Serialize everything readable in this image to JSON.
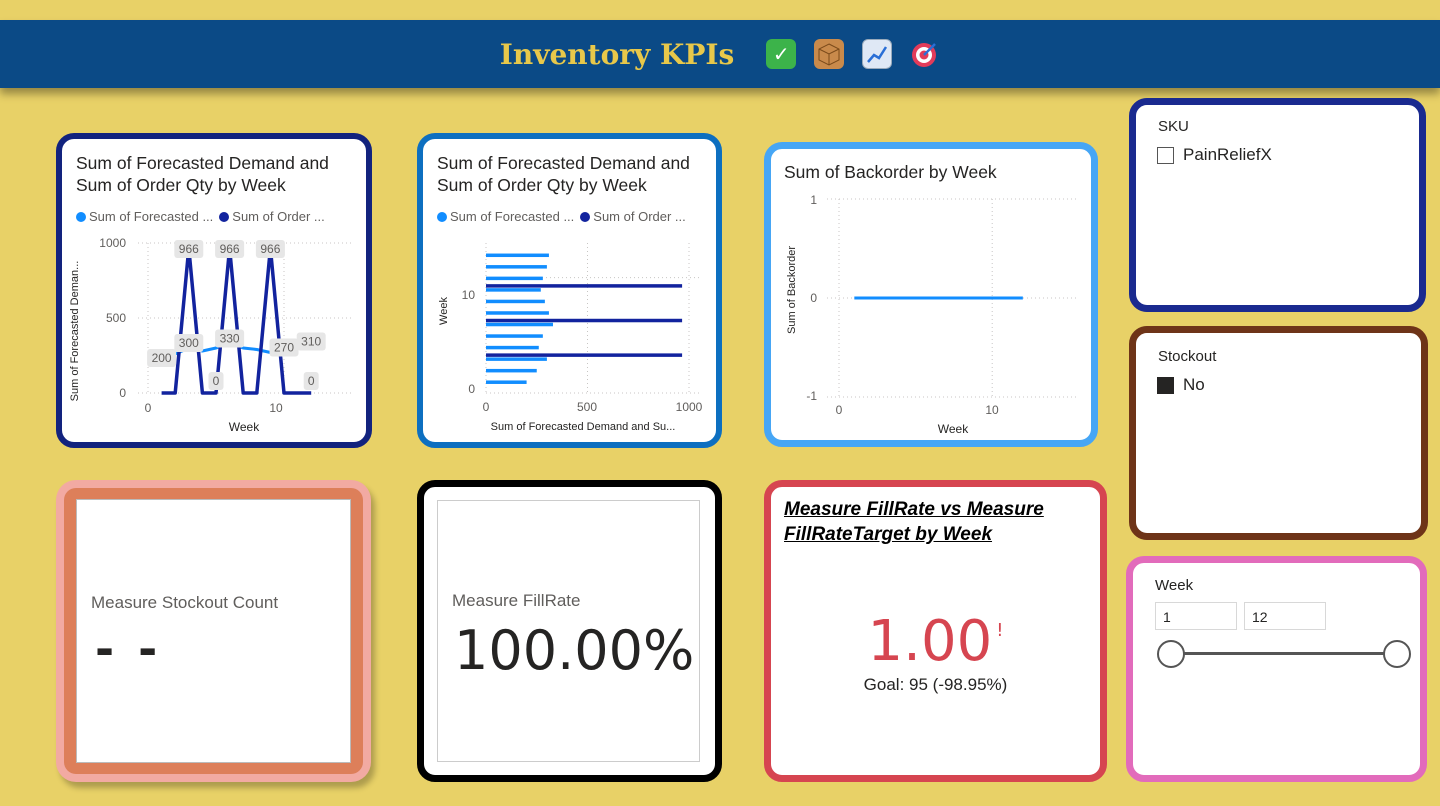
{
  "header": {
    "title": "Inventory KPIs",
    "icons": [
      "check-mark-icon",
      "package-icon",
      "chart-increasing-icon",
      "target-icon"
    ]
  },
  "charts": {
    "line": {
      "title_line1": "Sum of Forecasted Demand and",
      "title_line2": "Sum of Order Qty by Week",
      "legend": [
        "Sum of Forecasted ...",
        "Sum of Order ..."
      ],
      "ylabel": "Sum of Forecasted Deman...",
      "xlabel": "Week",
      "yticks": [
        "1000",
        "500",
        "0"
      ],
      "xticks": [
        "0",
        "10"
      ]
    },
    "bar": {
      "title_line1": "Sum of Forecasted Demand and",
      "title_line2": "Sum of Order Qty by Week",
      "legend": [
        "Sum of Forecasted ...",
        "Sum of Order ..."
      ],
      "ylabel": "Week",
      "xlabel": "Sum of Forecasted Demand and Su...",
      "yticks": [
        "10",
        "0"
      ],
      "xticks": [
        "0",
        "500",
        "1000"
      ]
    },
    "backorder": {
      "title": "Sum of Backorder by Week",
      "ylabel": "Sum of Backorder",
      "xlabel": "Week",
      "yticks": [
        "1",
        "0",
        "-1"
      ],
      "xticks": [
        "0",
        "10"
      ]
    }
  },
  "chart_data": [
    {
      "type": "line",
      "title": "Sum of Forecasted Demand and Sum of Order Qty by Week",
      "xlabel": "Week",
      "ylabel": "Sum of Forecasted Deman...",
      "xlim": [
        0,
        15
      ],
      "ylim": [
        0,
        1000
      ],
      "x": [
        1,
        2,
        3,
        4,
        5,
        6,
        7,
        8,
        9,
        10,
        11,
        12
      ],
      "series": [
        {
          "name": "Sum of Forecasted ...",
          "color": "#118dff",
          "values": [
            200,
            260,
            300,
            280,
            300,
            330,
            300,
            290,
            270,
            280,
            300,
            310
          ]
        },
        {
          "name": "Sum of Order ...",
          "color": "#12239e",
          "values": [
            0,
            0,
            966,
            0,
            0,
            966,
            0,
            0,
            966,
            0,
            0,
            0
          ]
        }
      ],
      "data_labels": [
        {
          "text": "200",
          "x": 1,
          "y": 200
        },
        {
          "text": "966",
          "x": 3,
          "y": 966
        },
        {
          "text": "300",
          "x": 3,
          "y": 300
        },
        {
          "text": "966",
          "x": 6,
          "y": 966
        },
        {
          "text": "0",
          "x": 5,
          "y": 0
        },
        {
          "text": "330",
          "x": 6,
          "y": 330
        },
        {
          "text": "966",
          "x": 9,
          "y": 966
        },
        {
          "text": "270",
          "x": 10,
          "y": 270
        },
        {
          "text": "310",
          "x": 12,
          "y": 310
        },
        {
          "text": "0",
          "x": 12,
          "y": 0
        }
      ]
    },
    {
      "type": "bar",
      "orientation": "horizontal",
      "title": "Sum of Forecasted Demand and Sum of Order Qty by Week",
      "xlabel": "Sum of Forecasted Demand and Su...",
      "ylabel": "Week",
      "xlim": [
        0,
        1000
      ],
      "ylim": [
        0,
        13
      ],
      "categories": [
        1,
        2,
        3,
        4,
        5,
        6,
        7,
        8,
        9,
        10,
        11,
        12
      ],
      "series": [
        {
          "name": "Sum of Forecasted ...",
          "color": "#118dff",
          "values": [
            200,
            250,
            300,
            260,
            280,
            330,
            310,
            290,
            270,
            280,
            300,
            310
          ]
        },
        {
          "name": "Sum of Order ...",
          "color": "#12239e",
          "values": [
            0,
            0,
            966,
            0,
            0,
            966,
            0,
            0,
            966,
            0,
            0,
            0
          ]
        }
      ]
    },
    {
      "type": "line",
      "title": "Sum of Backorder by Week",
      "xlabel": "Week",
      "ylabel": "Sum of Backorder",
      "xlim": [
        -1,
        15
      ],
      "ylim": [
        -1,
        1
      ],
      "x": [
        1,
        2,
        3,
        4,
        5,
        6,
        7,
        8,
        9,
        10,
        11,
        12
      ],
      "series": [
        {
          "name": "Sum of Backorder",
          "color": "#118dff",
          "values": [
            0,
            0,
            0,
            0,
            0,
            0,
            0,
            0,
            0,
            0,
            0,
            0
          ]
        }
      ]
    }
  ],
  "cards": {
    "stockout": {
      "label": "Measure Stockout Count",
      "value": "- -"
    },
    "fillrate": {
      "label": "Measure FillRate",
      "value": "100.00%"
    },
    "kpi": {
      "title_line1": "Measure FillRate vs Measure",
      "title_line2": "FillRateTarget by Week",
      "value": "1.00",
      "indicator": "!",
      "goal": "Goal: 95 (-98.95%)",
      "value_color": "#d64550"
    }
  },
  "slicers": {
    "sku": {
      "title": "SKU",
      "items": [
        {
          "label": "PainReliefX",
          "checked": false
        }
      ]
    },
    "stockout": {
      "title": "Stockout",
      "items": [
        {
          "label": "No",
          "checked": true
        }
      ]
    },
    "week": {
      "title": "Week",
      "min": "1",
      "max": "12"
    }
  }
}
